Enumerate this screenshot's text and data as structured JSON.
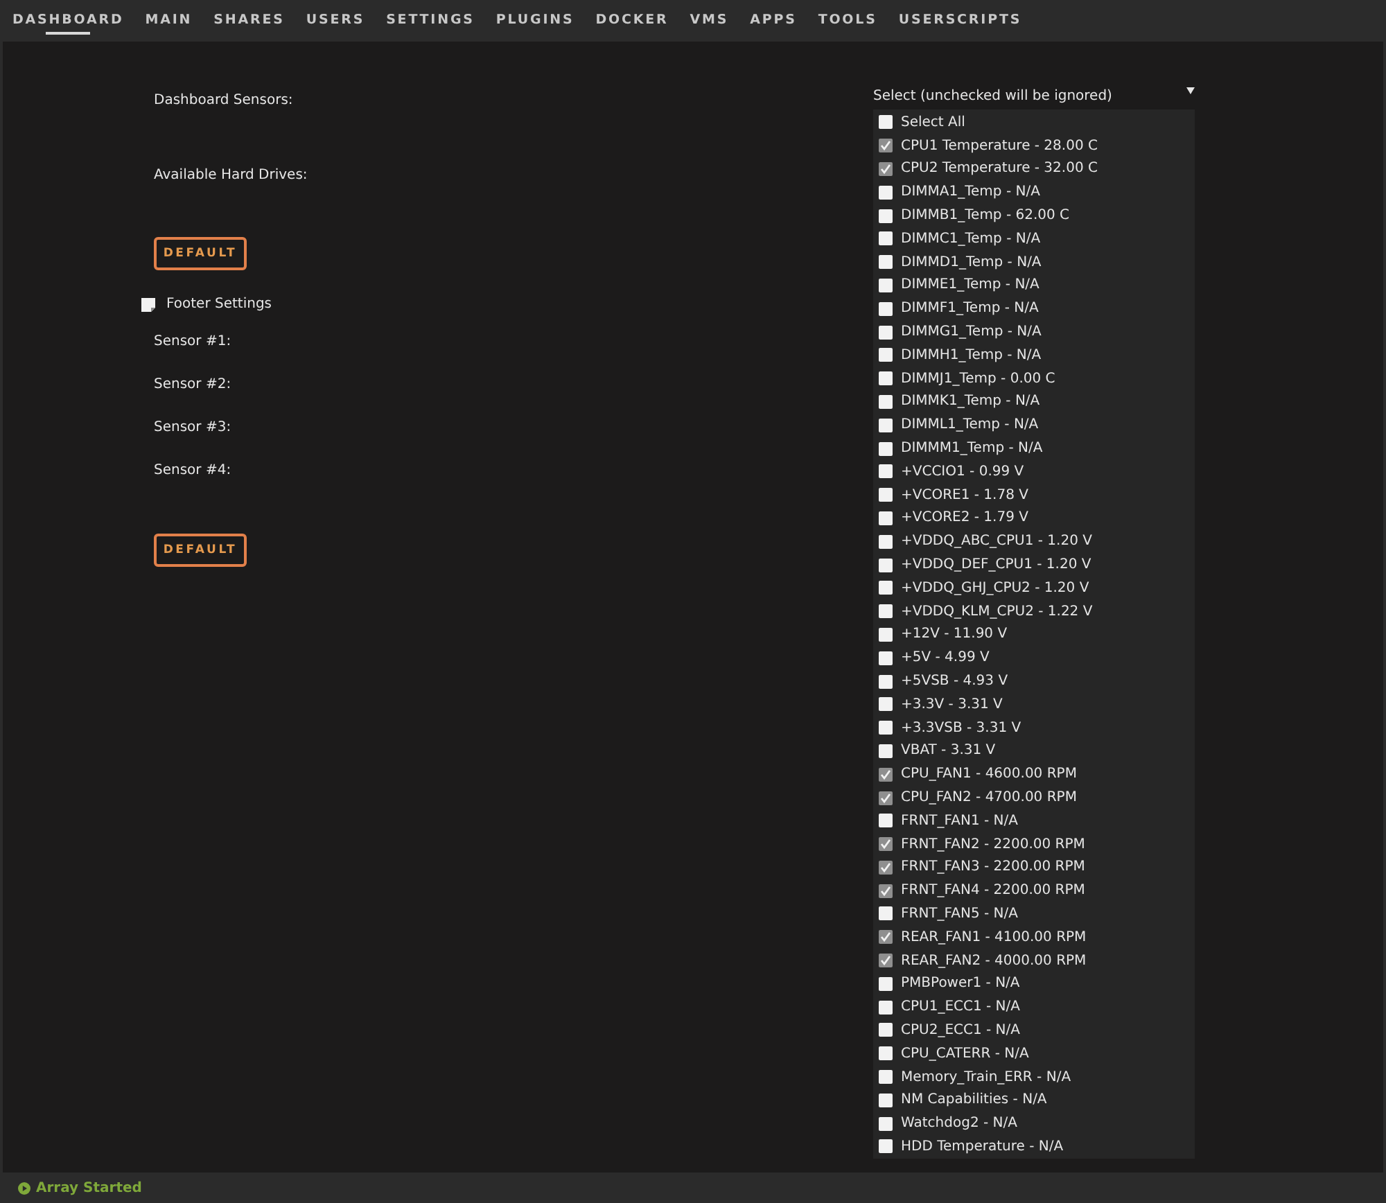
{
  "nav": [
    {
      "label": "DASHBOARD",
      "selected": true
    },
    {
      "label": "MAIN",
      "selected": false
    },
    {
      "label": "SHARES",
      "selected": false
    },
    {
      "label": "USERS",
      "selected": false
    },
    {
      "label": "SETTINGS",
      "selected": false
    },
    {
      "label": "PLUGINS",
      "selected": false
    },
    {
      "label": "DOCKER",
      "selected": false
    },
    {
      "label": "VMS",
      "selected": false
    },
    {
      "label": "APPS",
      "selected": false
    },
    {
      "label": "TOOLS",
      "selected": false
    },
    {
      "label": "USERSCRIPTS",
      "selected": false
    }
  ],
  "form": {
    "dashboard_sensors_label": "Dashboard Sensors:",
    "hard_drives_label": "Available Hard Drives:",
    "default_button": "DEFAULT",
    "footer_settings": "Footer Settings",
    "sensor_labels": [
      "Sensor #1:",
      "Sensor #2:",
      "Sensor #3:",
      "Sensor #4:"
    ],
    "footer_default_button": "DEFAULT"
  },
  "sensor_select": {
    "placeholder": "Select (unchecked will be ignored)",
    "options": [
      {
        "label": "Select All",
        "checked": false
      },
      {
        "label": "CPU1 Temperature - 28.00 C",
        "checked": true
      },
      {
        "label": "CPU2 Temperature - 32.00 C",
        "checked": true
      },
      {
        "label": "DIMMA1_Temp - N/A",
        "checked": false
      },
      {
        "label": "DIMMB1_Temp - 62.00 C",
        "checked": false
      },
      {
        "label": "DIMMC1_Temp - N/A",
        "checked": false
      },
      {
        "label": "DIMMD1_Temp - N/A",
        "checked": false
      },
      {
        "label": "DIMME1_Temp - N/A",
        "checked": false
      },
      {
        "label": "DIMMF1_Temp - N/A",
        "checked": false
      },
      {
        "label": "DIMMG1_Temp - N/A",
        "checked": false
      },
      {
        "label": "DIMMH1_Temp - N/A",
        "checked": false
      },
      {
        "label": "DIMMJ1_Temp - 0.00 C",
        "checked": false
      },
      {
        "label": "DIMMK1_Temp - N/A",
        "checked": false
      },
      {
        "label": "DIMML1_Temp - N/A",
        "checked": false
      },
      {
        "label": "DIMMM1_Temp - N/A",
        "checked": false
      },
      {
        "label": "+VCCIO1 - 0.99 V",
        "checked": false
      },
      {
        "label": "+VCORE1 - 1.78 V",
        "checked": false
      },
      {
        "label": "+VCORE2 - 1.79 V",
        "checked": false
      },
      {
        "label": "+VDDQ_ABC_CPU1 - 1.20 V",
        "checked": false
      },
      {
        "label": "+VDDQ_DEF_CPU1 - 1.20 V",
        "checked": false
      },
      {
        "label": "+VDDQ_GHJ_CPU2 - 1.20 V",
        "checked": false
      },
      {
        "label": "+VDDQ_KLM_CPU2 - 1.22 V",
        "checked": false
      },
      {
        "label": "+12V - 11.90 V",
        "checked": false
      },
      {
        "label": "+5V - 4.99 V",
        "checked": false
      },
      {
        "label": "+5VSB - 4.93 V",
        "checked": false
      },
      {
        "label": "+3.3V - 3.31 V",
        "checked": false
      },
      {
        "label": "+3.3VSB - 3.31 V",
        "checked": false
      },
      {
        "label": "VBAT - 3.31 V",
        "checked": false
      },
      {
        "label": "CPU_FAN1 - 4600.00 RPM",
        "checked": true
      },
      {
        "label": "CPU_FAN2 - 4700.00 RPM",
        "checked": true
      },
      {
        "label": "FRNT_FAN1 - N/A",
        "checked": false
      },
      {
        "label": "FRNT_FAN2 - 2200.00 RPM",
        "checked": true
      },
      {
        "label": "FRNT_FAN3 - 2200.00 RPM",
        "checked": true
      },
      {
        "label": "FRNT_FAN4 - 2200.00 RPM",
        "checked": true
      },
      {
        "label": "FRNT_FAN5 - N/A",
        "checked": false
      },
      {
        "label": "REAR_FAN1 - 4100.00 RPM",
        "checked": true
      },
      {
        "label": "REAR_FAN2 - 4000.00 RPM",
        "checked": true
      },
      {
        "label": "PMBPower1 - N/A",
        "checked": false
      },
      {
        "label": "CPU1_ECC1 - N/A",
        "checked": false
      },
      {
        "label": "CPU2_ECC1 - N/A",
        "checked": false
      },
      {
        "label": "CPU_CATERR - N/A",
        "checked": false
      },
      {
        "label": "Memory_Train_ERR - N/A",
        "checked": false
      },
      {
        "label": "NM Capabilities - N/A",
        "checked": false
      },
      {
        "label": "Watchdog2 - N/A",
        "checked": false
      },
      {
        "label": "HDD Temperature - N/A",
        "checked": false
      }
    ]
  },
  "status_bar": {
    "status": "Array Started"
  }
}
